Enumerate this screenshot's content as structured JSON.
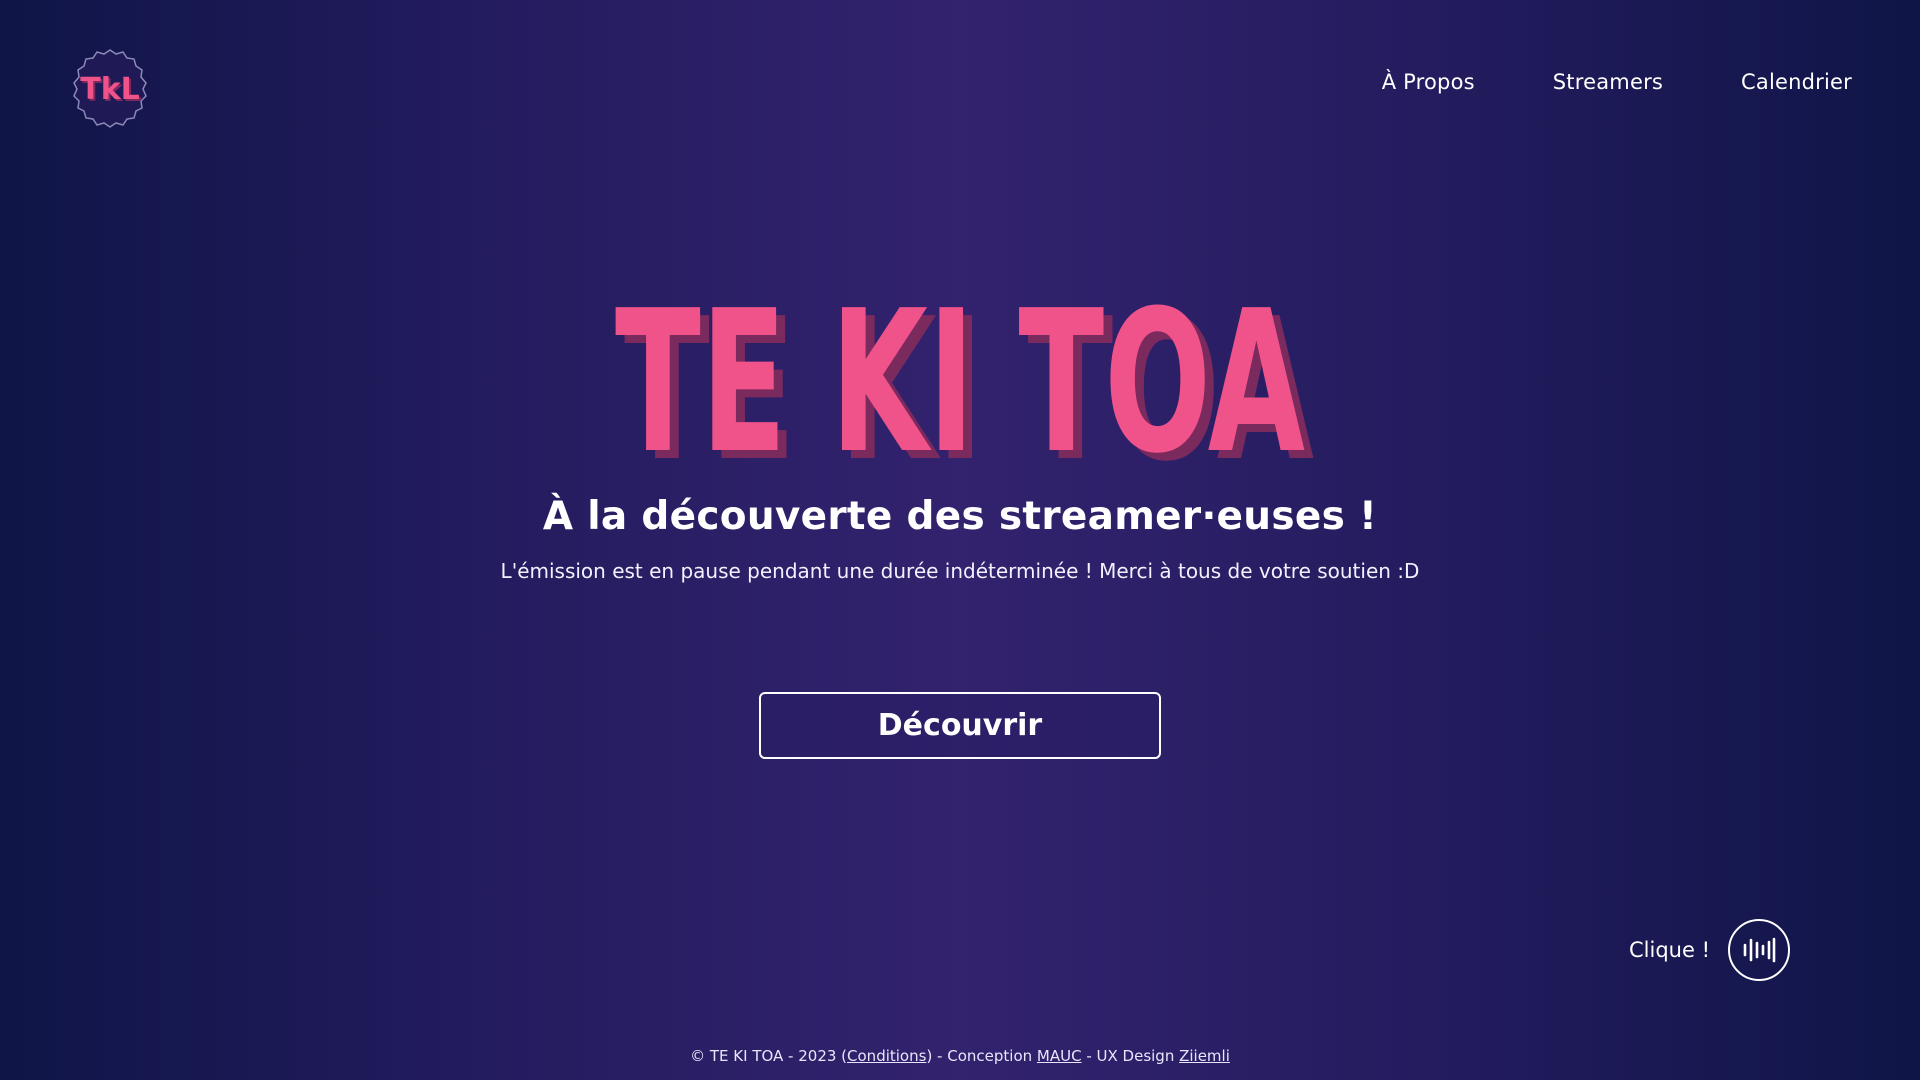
{
  "brand": {
    "logo_text": "TkL",
    "logo_icon": "tkl-badge-logo",
    "title": "TE KI TOA",
    "title_color": "#f0528a",
    "title_shadow_color": "#7b2a5e"
  },
  "nav": {
    "items": [
      {
        "label": "À Propos"
      },
      {
        "label": "Streamers"
      },
      {
        "label": "Calendrier"
      }
    ]
  },
  "hero": {
    "subtitle": "À la découverte des streamer·euses !",
    "tagline": "L'émission est en pause pendant une durée indéterminée ! Merci à tous de votre soutien :D",
    "cta_label": "Découvrir"
  },
  "sound": {
    "label": "Clique !",
    "icon": "audio-waveform-icon"
  },
  "footer": {
    "prefix": "© TE KI TOA - 2023 (",
    "conditions_label": "Conditions",
    "middle": ") - Conception ",
    "conception_label": "MAUC",
    "ux_prefix": " - UX Design ",
    "ux_label": "Ziiemli"
  },
  "colors": {
    "accent": "#f0528a",
    "background_center": "#33226e",
    "background_edge": "#0f1547",
    "text": "#ffffff"
  }
}
